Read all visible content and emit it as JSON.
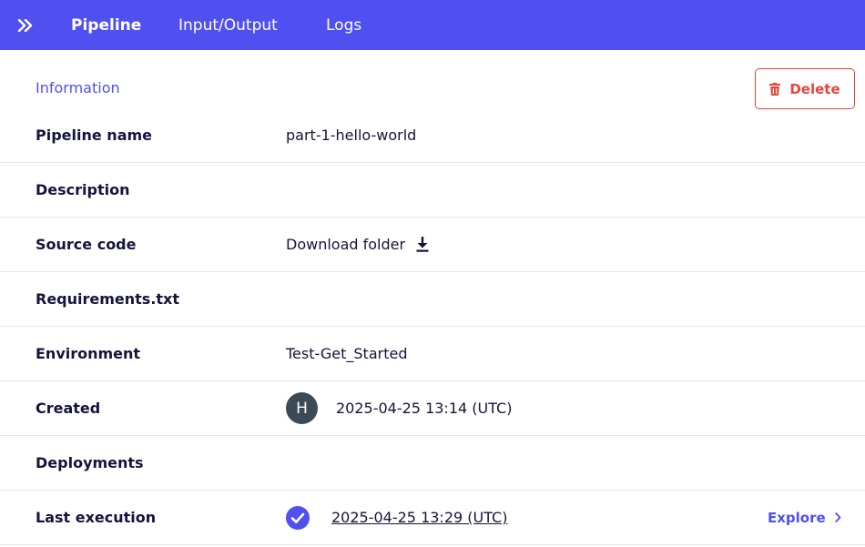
{
  "nav": {
    "tabs": [
      {
        "label": "Pipeline",
        "active": true
      },
      {
        "label": "Input/Output",
        "active": false
      },
      {
        "label": "Logs",
        "active": false
      }
    ],
    "expand_icon": "double-chevron-right-icon",
    "bar_color": "#5050f0"
  },
  "section": {
    "title": "Information",
    "delete_label": "Delete",
    "delete_icon": "trash-icon",
    "delete_color": "#e8443a"
  },
  "details": {
    "pipeline_name": {
      "label": "Pipeline name",
      "value": "part-1-hello-world"
    },
    "description": {
      "label": "Description",
      "value": ""
    },
    "source_code": {
      "label": "Source code",
      "value": "Download folder",
      "icon": "download-icon"
    },
    "requirements": {
      "label": "Requirements.txt",
      "value": ""
    },
    "environment": {
      "label": "Environment",
      "value": "Test-Get_Started"
    },
    "created": {
      "label": "Created",
      "avatar_initial": "H",
      "value": "2025-04-25 13:14 (UTC)"
    },
    "deployments": {
      "label": "Deployments",
      "value": ""
    },
    "last_execution": {
      "label": "Last execution",
      "status_icon": "check-circle-icon",
      "value": "2025-04-25 13:29 (UTC)",
      "action_label": "Explore",
      "action_icon": "chevron-right-icon"
    }
  }
}
